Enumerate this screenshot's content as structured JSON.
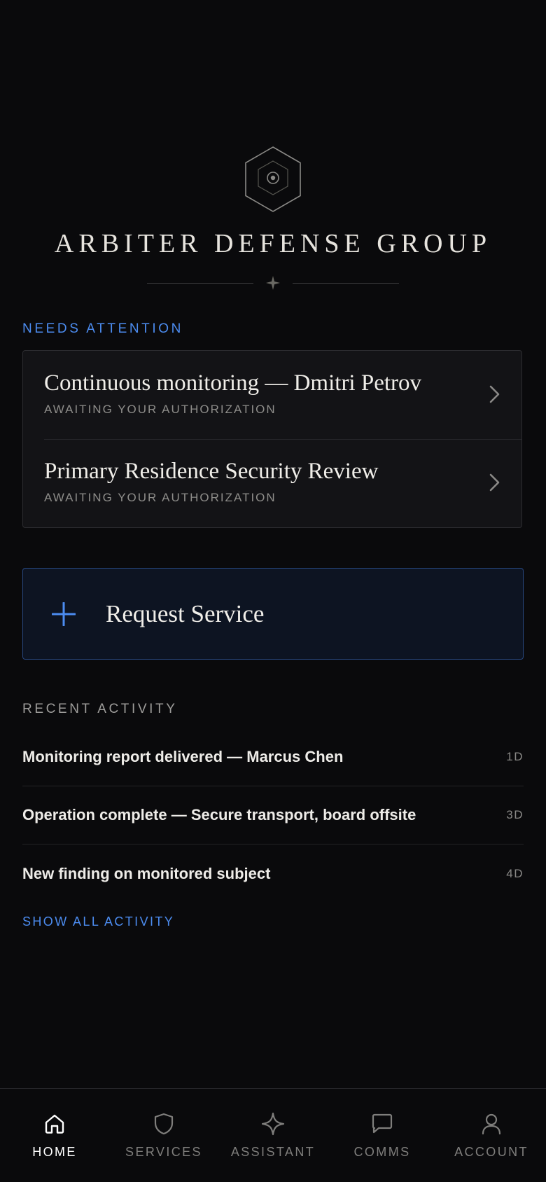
{
  "brand": {
    "name": "ARBITER DEFENSE GROUP",
    "logo_icon": "hexagon-seal-icon",
    "divider_icon": "four-point-star-icon"
  },
  "needs_attention": {
    "label": "NEEDS ATTENTION",
    "items": [
      {
        "title": "Continuous monitoring — Dmitri Petrov",
        "status": "AWAITING YOUR AUTHORIZATION"
      },
      {
        "title": "Primary Residence Security Review",
        "status": "AWAITING YOUR AUTHORIZATION"
      }
    ]
  },
  "request_service": {
    "label": "Request Service",
    "icon": "plus-icon"
  },
  "recent_activity": {
    "label": "RECENT ACTIVITY",
    "items": [
      {
        "text": "Monitoring report delivered — Marcus Chen",
        "age": "1D"
      },
      {
        "text": "Operation complete — Secure transport, board offsite",
        "age": "3D"
      },
      {
        "text": "New finding on monitored subject",
        "age": "4D"
      }
    ],
    "show_all": "SHOW ALL ACTIVITY"
  },
  "nav": {
    "items": [
      {
        "label": "HOME",
        "icon": "home-icon",
        "active": true
      },
      {
        "label": "SERVICES",
        "icon": "shield-icon",
        "active": false
      },
      {
        "label": "ASSISTANT",
        "icon": "sparkle-icon",
        "active": false
      },
      {
        "label": "COMMS",
        "icon": "chat-bubble-icon",
        "active": false
      },
      {
        "label": "ACCOUNT",
        "icon": "user-icon",
        "active": false
      }
    ]
  },
  "colors": {
    "background": "#0a0a0c",
    "accent_blue": "#4c8cf0",
    "card_background": "#131316",
    "request_background": "#0d1422",
    "request_border": "#27467e"
  }
}
